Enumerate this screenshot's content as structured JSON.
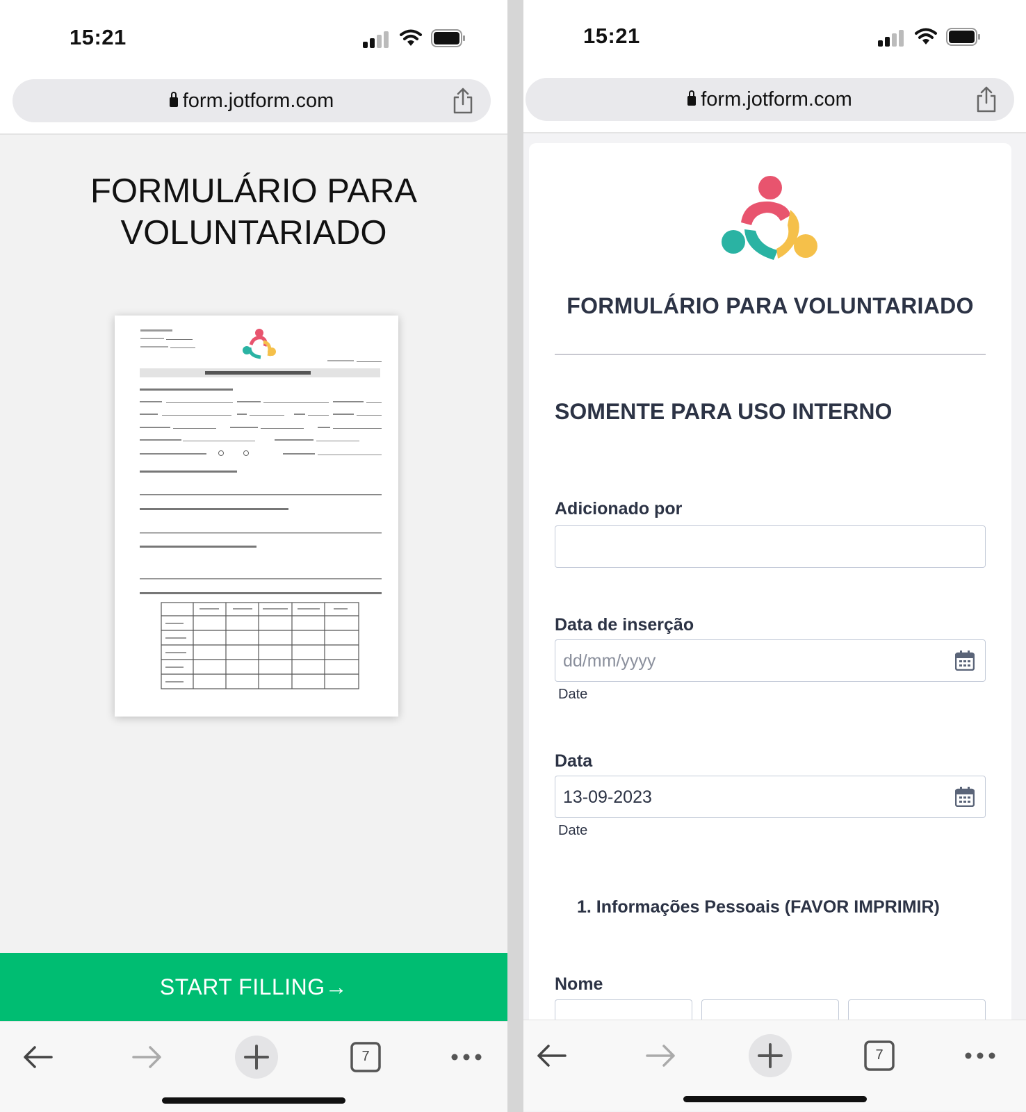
{
  "status": {
    "time": "15:21"
  },
  "browser": {
    "url": "form.jotform.com",
    "tab_count": "7"
  },
  "left": {
    "title_line1": "FORMULÁRIO PARA",
    "title_line2": "VOLUNTARIADO",
    "start_button": "START FILLING",
    "start_arrow": "→"
  },
  "right": {
    "form_title": "FORMULÁRIO PARA VOLUNTARIADO",
    "section_title": "SOMENTE PARA USO INTERNO",
    "fields": {
      "added_by": {
        "label": "Adicionado por",
        "value": ""
      },
      "insert_date": {
        "label": "Data de inserção",
        "placeholder": "dd/mm/yyyy",
        "sublabel": "Date"
      },
      "date": {
        "label": "Data",
        "value": "13-09-2023",
        "sublabel": "Date"
      }
    },
    "personal_info_heading": "1. Informações Pessoais (FAVOR IMPRIMIR)",
    "name_label": "Nome"
  },
  "colors": {
    "accent_green": "#00bd72",
    "logo_pink": "#e8546e",
    "logo_teal": "#2ab3a3",
    "logo_yellow": "#f5c04a",
    "text_dark": "#2c3345"
  },
  "icons": [
    "lock-icon",
    "share-icon",
    "back-arrow-icon",
    "forward-arrow-icon",
    "plus-icon",
    "tabs-icon",
    "more-icon",
    "calendar-icon",
    "signal-icon",
    "wifi-icon",
    "battery-icon"
  ]
}
